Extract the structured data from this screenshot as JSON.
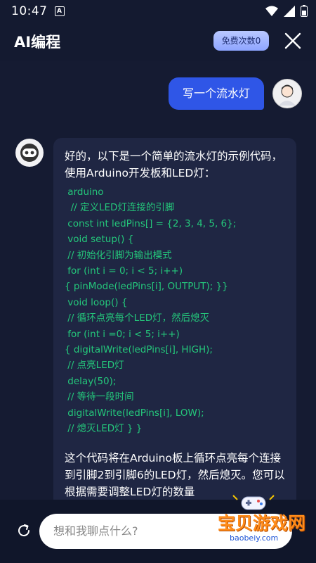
{
  "status": {
    "time": "10:47",
    "notif_letter": "A"
  },
  "header": {
    "title": "AI编程",
    "quota_label": "免费次数0"
  },
  "chat": {
    "user_message": "写一个流水灯",
    "bot_intro": "好的，以下是一个简单的流水灯的示例代码，使用Arduino开发板和LED灯：",
    "code_lines": [
      " arduino",
      "  // 定义LED灯连接的引脚",
      " const int ledPins[] = {2, 3, 4, 5, 6};",
      " void setup() {",
      " // 初始化引脚为输出模式",
      " for (int i = 0; i < 5; i++)",
      "{ pinMode(ledPins[i], OUTPUT); }}",
      " void loop() {",
      " // 循环点亮每个LED灯，然后熄灭",
      " for (int i =0; i < 5; i++)",
      "{ digitalWrite(ledPins[i], HIGH);",
      " // 点亮LED灯",
      " delay(50);",
      " // 等待一段时间",
      " digitalWrite(ledPins[i], LOW);",
      " // 熄灭LED灯 } }"
    ],
    "bot_outro": " 这个代码将在Arduino板上循环点亮每个连接到引脚2到引脚6的LED灯，然后熄灭。您可以根据需要调整LED灯的数量"
  },
  "input": {
    "placeholder": "想和我聊点什么?"
  },
  "watermark": {
    "text": "宝贝游戏网",
    "url": "baobeiy.com"
  },
  "colors": {
    "accent": "#2f56e7",
    "code": "#24c77b",
    "background": "#151b32"
  }
}
